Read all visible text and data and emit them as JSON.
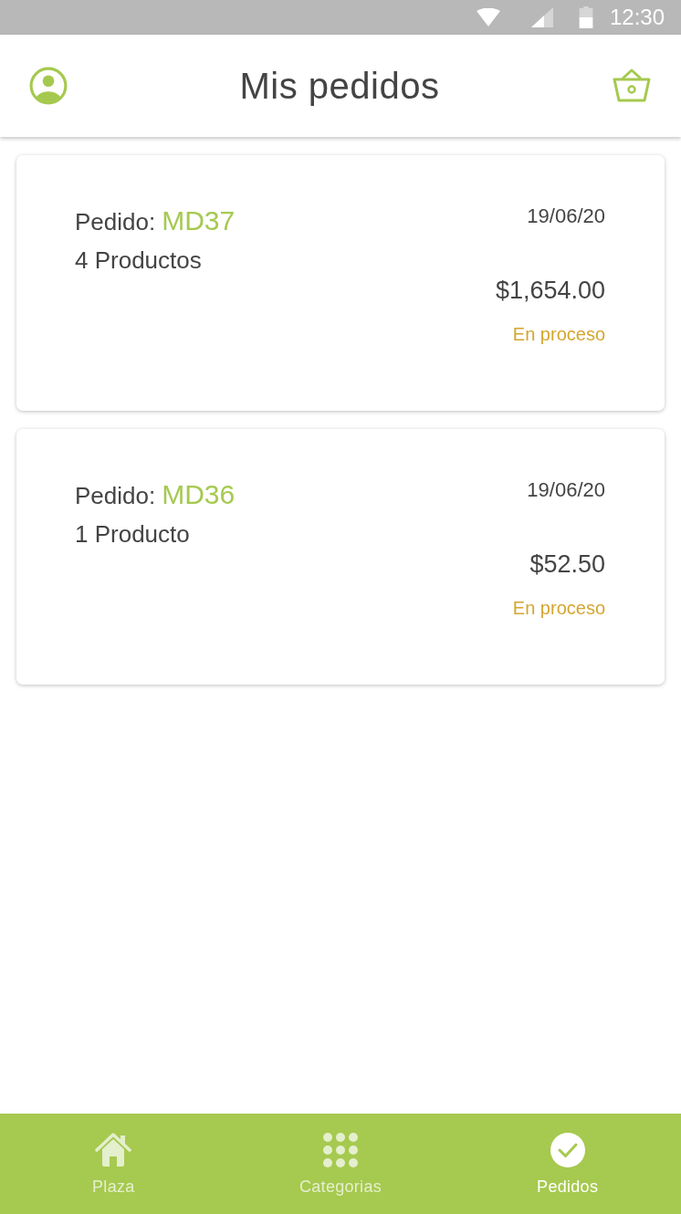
{
  "status_bar": {
    "time": "12:30"
  },
  "header": {
    "title": "Mis pedidos"
  },
  "orders": [
    {
      "label": "Pedido:",
      "code": "MD37",
      "products": "4 Productos",
      "date": "19/06/20",
      "total": "$1,654.00",
      "status": "En proceso"
    },
    {
      "label": "Pedido:",
      "code": "MD36",
      "products": "1 Producto",
      "date": "19/06/20",
      "total": "$52.50",
      "status": "En proceso"
    }
  ],
  "bottom_nav": [
    {
      "label": "Plaza",
      "kind": "home",
      "selected": false
    },
    {
      "label": "Categorias",
      "kind": "grid",
      "selected": false
    },
    {
      "label": "Pedidos",
      "kind": "check",
      "selected": true
    }
  ]
}
